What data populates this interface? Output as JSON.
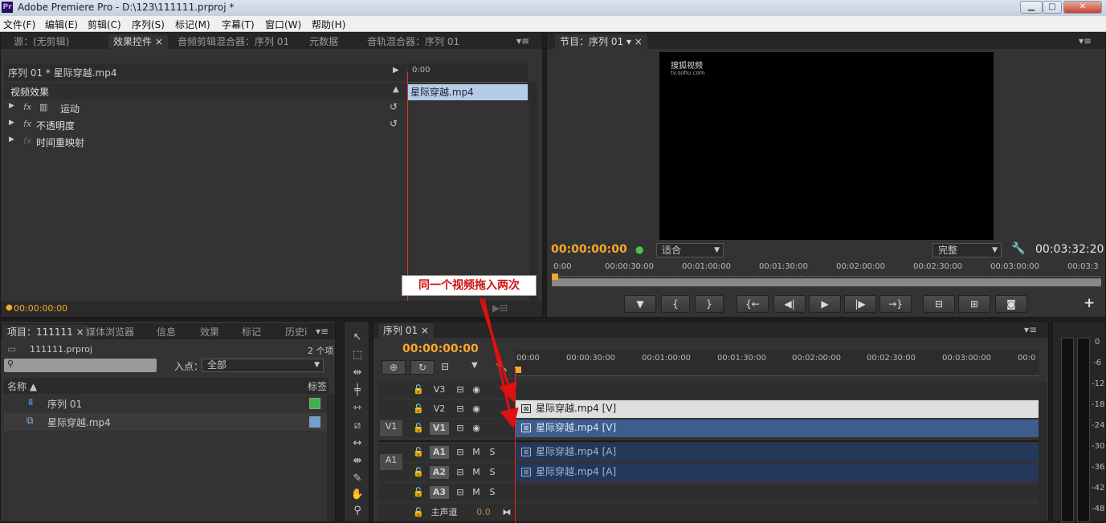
{
  "titlebar": {
    "app_icon": "Pr",
    "title": "Adobe Premiere Pro - D:\\123\\111111.prproj *"
  },
  "menu": [
    "文件(F)",
    "编辑(E)",
    "剪辑(C)",
    "序列(S)",
    "标记(M)",
    "字幕(T)",
    "窗口(W)",
    "帮助(H)"
  ],
  "source_panel": {
    "tabs": [
      "源：(无剪辑)",
      "效果控件",
      "音频剪辑混合器：序列 01",
      "元数据",
      "音轨混合器：序列 01"
    ],
    "close_mark": "×",
    "header": "序列 01 * 星际穿越.mp4",
    "section": "视频效果",
    "effects": [
      {
        "fx": "fx",
        "name": "运动"
      },
      {
        "fx": "fx",
        "name": "不透明度"
      },
      {
        "fx": "fx",
        "name": "时间重映射"
      }
    ],
    "ruler_time": "0:00",
    "clip_name": "星际穿越.mp4",
    "timecode": "00:00:00:00"
  },
  "program": {
    "tab": "节目：序列 01",
    "watermark_line1": "搜狐视频",
    "watermark_line2": "tv.sohu.com",
    "timecode": "00:00:00:00",
    "fit": "适合",
    "quality": "完整",
    "duration": "00:03:32:20",
    "ruler": [
      "0:00",
      "00:00:30:00",
      "00:01:00:00",
      "00:01:30:00",
      "00:02:00:00",
      "00:02:30:00",
      "00:03:00:00",
      "00:03:3"
    ],
    "transport": [
      "▼",
      "{",
      "}",
      "{←",
      "◀|",
      "▶",
      "|▶",
      "→}",
      "⊟",
      "⊞",
      "◙",
      "+"
    ]
  },
  "annotation": "同一个视频拖入两次",
  "project": {
    "tabs": [
      "项目：111111",
      "媒体浏览器",
      "信息",
      "效果",
      "标记",
      "历史i"
    ],
    "file": "111111.prproj",
    "count": "2 个项",
    "search_placeholder": "",
    "in_label": "入点：",
    "in_value": "全部",
    "col_name": "名称",
    "col_label": "标签",
    "items": [
      {
        "name": "序列 01",
        "icon": "sequence-icon",
        "color": "#3cb44b"
      },
      {
        "name": "星际穿越.mp4",
        "icon": "video-file-icon",
        "color": "#6f9fd8"
      }
    ]
  },
  "timeline": {
    "tab": "序列 01",
    "timecode": "00:00:00:00",
    "ruler": [
      "00:00",
      "00:00:30:00",
      "00:01:00:00",
      "00:01:30:00",
      "00:02:00:00",
      "00:02:30:00",
      "00:03:00:00",
      "00:0"
    ],
    "video_tracks": [
      {
        "target": "",
        "name": "V3",
        "clip": ""
      },
      {
        "target": "",
        "name": "V2",
        "clip": "星际穿越.mp4 [V]"
      },
      {
        "target": "V1",
        "name": "V1",
        "clip": "星际穿越.mp4 [V]"
      }
    ],
    "audio_tracks": [
      {
        "target": "A1",
        "name": "A1",
        "clip": "星际穿越.mp4 [A]"
      },
      {
        "target": "",
        "name": "A2",
        "clip": "星际穿越.mp4 [A]"
      },
      {
        "target": "",
        "name": "A3",
        "clip": ""
      }
    ],
    "master": {
      "name": "主声道",
      "value": "0.0"
    },
    "track_m": "M",
    "track_s": "S"
  },
  "meter": {
    "labels": [
      "0",
      "-6",
      "-12",
      "-18",
      "-24",
      "-30",
      "-36",
      "-42",
      "-48"
    ]
  }
}
